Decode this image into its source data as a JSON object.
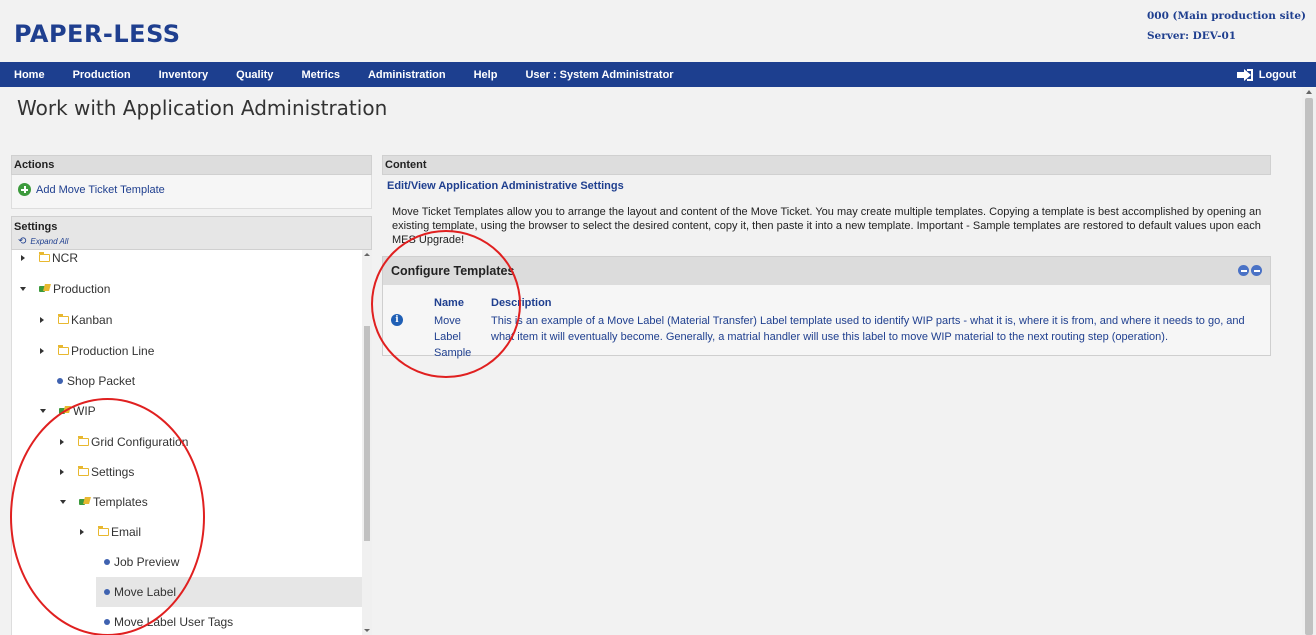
{
  "header": {
    "logo": "PAPER-LESS",
    "site": "000 (Main production site)",
    "server": "Server: DEV-01"
  },
  "nav": {
    "items": [
      "Home",
      "Production",
      "Inventory",
      "Quality",
      "Metrics",
      "Administration",
      "Help",
      "User : System Administrator"
    ],
    "logout": "Logout"
  },
  "page": {
    "title": "Work with Application Administration"
  },
  "actions": {
    "header": "Actions",
    "add_template": "Add Move Ticket Template"
  },
  "settings": {
    "header": "Settings",
    "expand_all": "Expand All",
    "tree": [
      {
        "label": "NCR",
        "type": "folder"
      },
      {
        "label": "Production",
        "type": "open"
      },
      {
        "label": "Kanban",
        "type": "folder"
      },
      {
        "label": "Production Line",
        "type": "folder"
      },
      {
        "label": "Shop Packet",
        "type": "leaf"
      },
      {
        "label": "WIP",
        "type": "open"
      },
      {
        "label": "Grid Configuration",
        "type": "folder"
      },
      {
        "label": "Settings",
        "type": "folder"
      },
      {
        "label": "Templates",
        "type": "open"
      },
      {
        "label": "Email",
        "type": "folder"
      },
      {
        "label": "Job Preview",
        "type": "leaf"
      },
      {
        "label": "Move Label",
        "type": "leaf",
        "selected": true
      },
      {
        "label": "Move Label User Tags",
        "type": "leaf"
      }
    ]
  },
  "content": {
    "header": "Content",
    "link": "Edit/View Application Administrative Settings",
    "description": "Move Ticket Templates allow you to arrange the layout and content of the Move Ticket. You may create multiple templates. Copying a template is best accomplished by opening an existing template, using the browser to select the desired content, copy it, then paste it into a new template. Important - Sample templates are restored to default values upon each MES Upgrade!",
    "config": {
      "title": "Configure Templates",
      "col_name": "Name",
      "col_desc": "Description",
      "row_name": "Move Label Sample",
      "row_desc": "This is an example of a Move Label (Material Transfer) Label template used to identify WIP parts - what it is, where it is from, and where it needs to go, and what item it will eventually become. Generally, a matrial handler will use this label to move WIP material to the next routing step (operation)."
    }
  },
  "colors": {
    "brand": "#1f3f8f",
    "nav_bg": "#1d3f8f",
    "annotation": "#e02020"
  }
}
